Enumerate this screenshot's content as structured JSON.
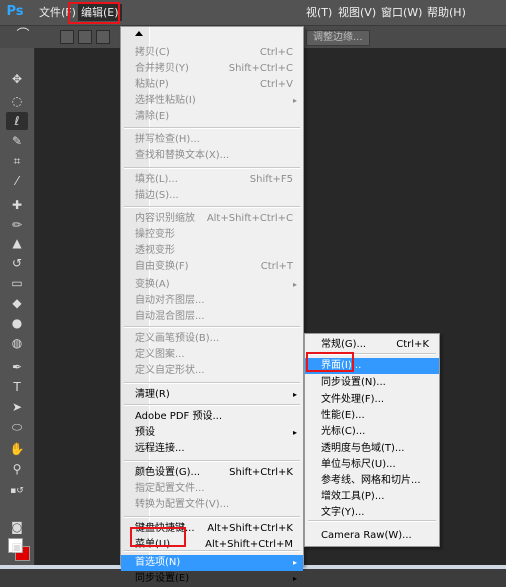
{
  "menubar": {
    "logo": "Ps",
    "items": [
      "文件(F)",
      "编辑(E)",
      "视图(V)",
      "窗口(W)",
      "帮助(H)"
    ],
    "partial_item": "视(T)"
  },
  "options_bar": {
    "adjust_label": "调整边缘..."
  },
  "edit_menu": {
    "items": [
      {
        "label": "拷贝(C)",
        "shortcut": "Ctrl+C",
        "disabled": true
      },
      {
        "label": "合并拷贝(Y)",
        "shortcut": "Shift+Ctrl+C",
        "disabled": true
      },
      {
        "label": "粘贴(P)",
        "shortcut": "Ctrl+V",
        "disabled": true
      },
      {
        "label": "选择性粘贴(I)",
        "shortcut": "▸",
        "disabled": true
      },
      {
        "label": "清除(E)",
        "shortcut": "",
        "disabled": true
      },
      {
        "label": "拼写检查(H)...",
        "shortcut": "",
        "disabled": true
      },
      {
        "label": "查找和替换文本(X)...",
        "shortcut": "",
        "disabled": true
      },
      {
        "label": "填充(L)...",
        "shortcut": "Shift+F5",
        "disabled": true
      },
      {
        "label": "描边(S)...",
        "shortcut": "",
        "disabled": true
      },
      {
        "label": "内容识别缩放",
        "shortcut": "Alt+Shift+Ctrl+C",
        "disabled": true
      },
      {
        "label": "操控变形",
        "shortcut": "",
        "disabled": true
      },
      {
        "label": "透视变形",
        "shortcut": "",
        "disabled": true
      },
      {
        "label": "自由变换(F)",
        "shortcut": "Ctrl+T",
        "disabled": true
      },
      {
        "label": "变换(A)",
        "shortcut": "▸",
        "disabled": true
      },
      {
        "label": "自动对齐图层...",
        "shortcut": "",
        "disabled": true
      },
      {
        "label": "自动混合图层...",
        "shortcut": "",
        "disabled": true
      },
      {
        "label": "定义画笔预设(B)...",
        "shortcut": "",
        "disabled": true
      },
      {
        "label": "定义图案...",
        "shortcut": "",
        "disabled": true
      },
      {
        "label": "定义自定形状...",
        "shortcut": "",
        "disabled": true
      },
      {
        "label": "清理(R)",
        "shortcut": "▸",
        "disabled": false
      },
      {
        "label": "Adobe PDF 预设...",
        "shortcut": "",
        "disabled": false
      },
      {
        "label": "预设",
        "shortcut": "▸",
        "disabled": false
      },
      {
        "label": "远程连接...",
        "shortcut": "",
        "disabled": false
      },
      {
        "label": "颜色设置(G)...",
        "shortcut": "Shift+Ctrl+K",
        "disabled": false
      },
      {
        "label": "指定配置文件...",
        "shortcut": "",
        "disabled": true
      },
      {
        "label": "转换为配置文件(V)...",
        "shortcut": "",
        "disabled": true
      },
      {
        "label": "键盘快捷键...",
        "shortcut": "Alt+Shift+Ctrl+K",
        "disabled": false
      },
      {
        "label": "菜单(U)...",
        "shortcut": "Alt+Shift+Ctrl+M",
        "disabled": false
      },
      {
        "label": "首选项(N)",
        "shortcut": "▸",
        "disabled": false
      },
      {
        "label": "同步设置(E)",
        "shortcut": "▸",
        "disabled": false
      }
    ]
  },
  "prefs_menu": {
    "items": [
      {
        "label": "常规(G)...",
        "shortcut": "Ctrl+K"
      },
      {
        "label": "界面(I)...",
        "shortcut": ""
      },
      {
        "label": "同步设置(N)...",
        "shortcut": ""
      },
      {
        "label": "文件处理(F)...",
        "shortcut": ""
      },
      {
        "label": "性能(E)...",
        "shortcut": ""
      },
      {
        "label": "光标(C)...",
        "shortcut": ""
      },
      {
        "label": "透明度与色域(T)...",
        "shortcut": ""
      },
      {
        "label": "单位与标尺(U)...",
        "shortcut": ""
      },
      {
        "label": "参考线、网格和切片...",
        "shortcut": ""
      },
      {
        "label": "增效工具(P)...",
        "shortcut": ""
      },
      {
        "label": "文字(Y)...",
        "shortcut": ""
      },
      {
        "label": "Camera Raw(W)...",
        "shortcut": ""
      }
    ]
  },
  "colors": {
    "highlight": "#3399ff",
    "annotation": "#e8141a",
    "logo": "#31a8ff"
  }
}
